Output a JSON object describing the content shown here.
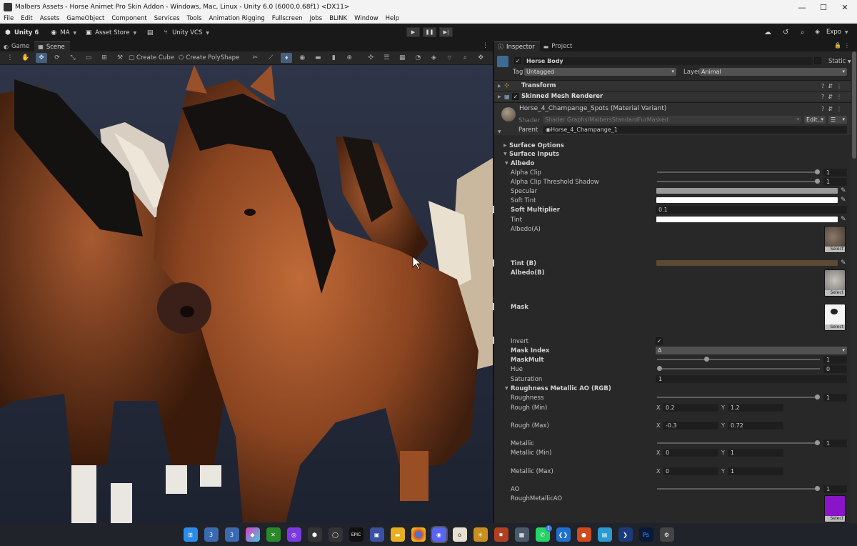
{
  "window": {
    "title": "Malbers Assets - Horse Animet Pro Skin Addon - Windows, Mac, Linux - Unity 6.0 (6000.0.68f1) <DX11>",
    "minimize": "—",
    "maximize": "☐",
    "close": "✕"
  },
  "menu": [
    "File",
    "Edit",
    "Assets",
    "GameObject",
    "Component",
    "Services",
    "Tools",
    "Animation Rigging",
    "Fullscreen",
    "Jobs",
    "BLINK",
    "Window",
    "Help"
  ],
  "toolbar": {
    "unity": "Unity 6",
    "account": "MA",
    "asset_store": "Asset Store",
    "vcs": "Unity VCS",
    "layout": "Expo"
  },
  "tabs": {
    "game": "Game",
    "scene": "Scene",
    "inspector": "Inspector",
    "project": "Project"
  },
  "scene_tools": {
    "create_cube": "Create Cube",
    "create_polyshape": "Create PolyShape"
  },
  "inspector": {
    "object_name": "Horse Body",
    "static": "Static",
    "tag_label": "Tag",
    "tag_value": "Untagged",
    "layer_label": "Layer",
    "layer_value": "Animal",
    "transform": "Transform",
    "skinned": "Skinned Mesh Renderer",
    "material_name": "Horse_4_Champange_Spots (Material Variant)",
    "shader_label": "Shader",
    "shader_value": "Shader Graphs/MalbersStandardFurMasked",
    "edit": "Edit...",
    "parent_label": "Parent",
    "parent_value": "Horse_4_Champange_1",
    "surface_options": "Surface Options",
    "surface_inputs": "Surface Inputs",
    "albedo": "Albedo",
    "alpha_clip": "Alpha Clip",
    "alpha_clip_val": "1",
    "alpha_shadow": "Alpha Clip Threshold Shadow",
    "alpha_shadow_val": "1",
    "specular": "Specular",
    "soft_tint": "Soft Tint",
    "soft_mult": "Soft Multiplier",
    "soft_mult_val": "0.1",
    "tint": "Tint",
    "albedo_a": "Albedo(A)",
    "tint_b": "Tint (B)",
    "albedo_b": "Albedo(B)",
    "mask": "Mask",
    "invert": "Invert",
    "mask_index": "Mask Index",
    "mask_index_val": "A",
    "maskmult": "MaskMult",
    "maskmult_val": "1",
    "hue": "Hue",
    "hue_val": "0",
    "saturation": "Saturation",
    "saturation_val": "1",
    "rma": "Roughness Metallic AO (RGB)",
    "roughness": "Roughness",
    "roughness_val": "1",
    "rough_min": "Rough (Min)",
    "rough_min_x": "0.2",
    "rough_min_y": "1.2",
    "rough_max": "Rough (Max)",
    "rough_max_x": "-0.3",
    "rough_max_y": "0.72",
    "metallic": "Metallic",
    "metallic_val": "1",
    "metallic_min": "Metallic (Min)",
    "metallic_min_x": "0",
    "metallic_min_y": "1",
    "metallic_max": "Metallic (Max)",
    "metallic_max_x": "0",
    "metallic_max_y": "1",
    "ao": "AO",
    "ao_val": "1",
    "roughmetalao": "RoughMetallicAO",
    "select": "Select",
    "x": "X",
    "y": "Y"
  },
  "sliders": {
    "alpha_clip": 1.0,
    "alpha_shadow": 1.0,
    "maskmult": 0.3,
    "hue": 0.0,
    "roughness": 1.0,
    "metallic": 1.0,
    "ao": 1.0
  },
  "colors": {
    "specular": "#9a9a9a",
    "soft_tint": "#ffffff",
    "tint": "#ffffff",
    "tint_b": "#5c4a35"
  },
  "taskbar_icons": [
    "windows-icon",
    "app-3-icon",
    "app-3b-icon",
    "copilot-icon",
    "xbox-icon",
    "app-icon",
    "unity-hub-icon",
    "unity-icon",
    "epic-icon",
    "save-icon",
    "explorer-icon",
    "chrome-icon",
    "discord-icon",
    "app-o-icon",
    "sun-app-icon",
    "star-app-icon",
    "calculator-icon",
    "whatsapp-icon",
    "vscode-icon",
    "app-dot-icon",
    "grid-app-icon",
    "powershell-icon",
    "photoshop-icon",
    "unity-settings-icon"
  ],
  "taskbar_badge": "1",
  "taskbar_epic": "EPIC",
  "taskbar_ps": "Ps"
}
